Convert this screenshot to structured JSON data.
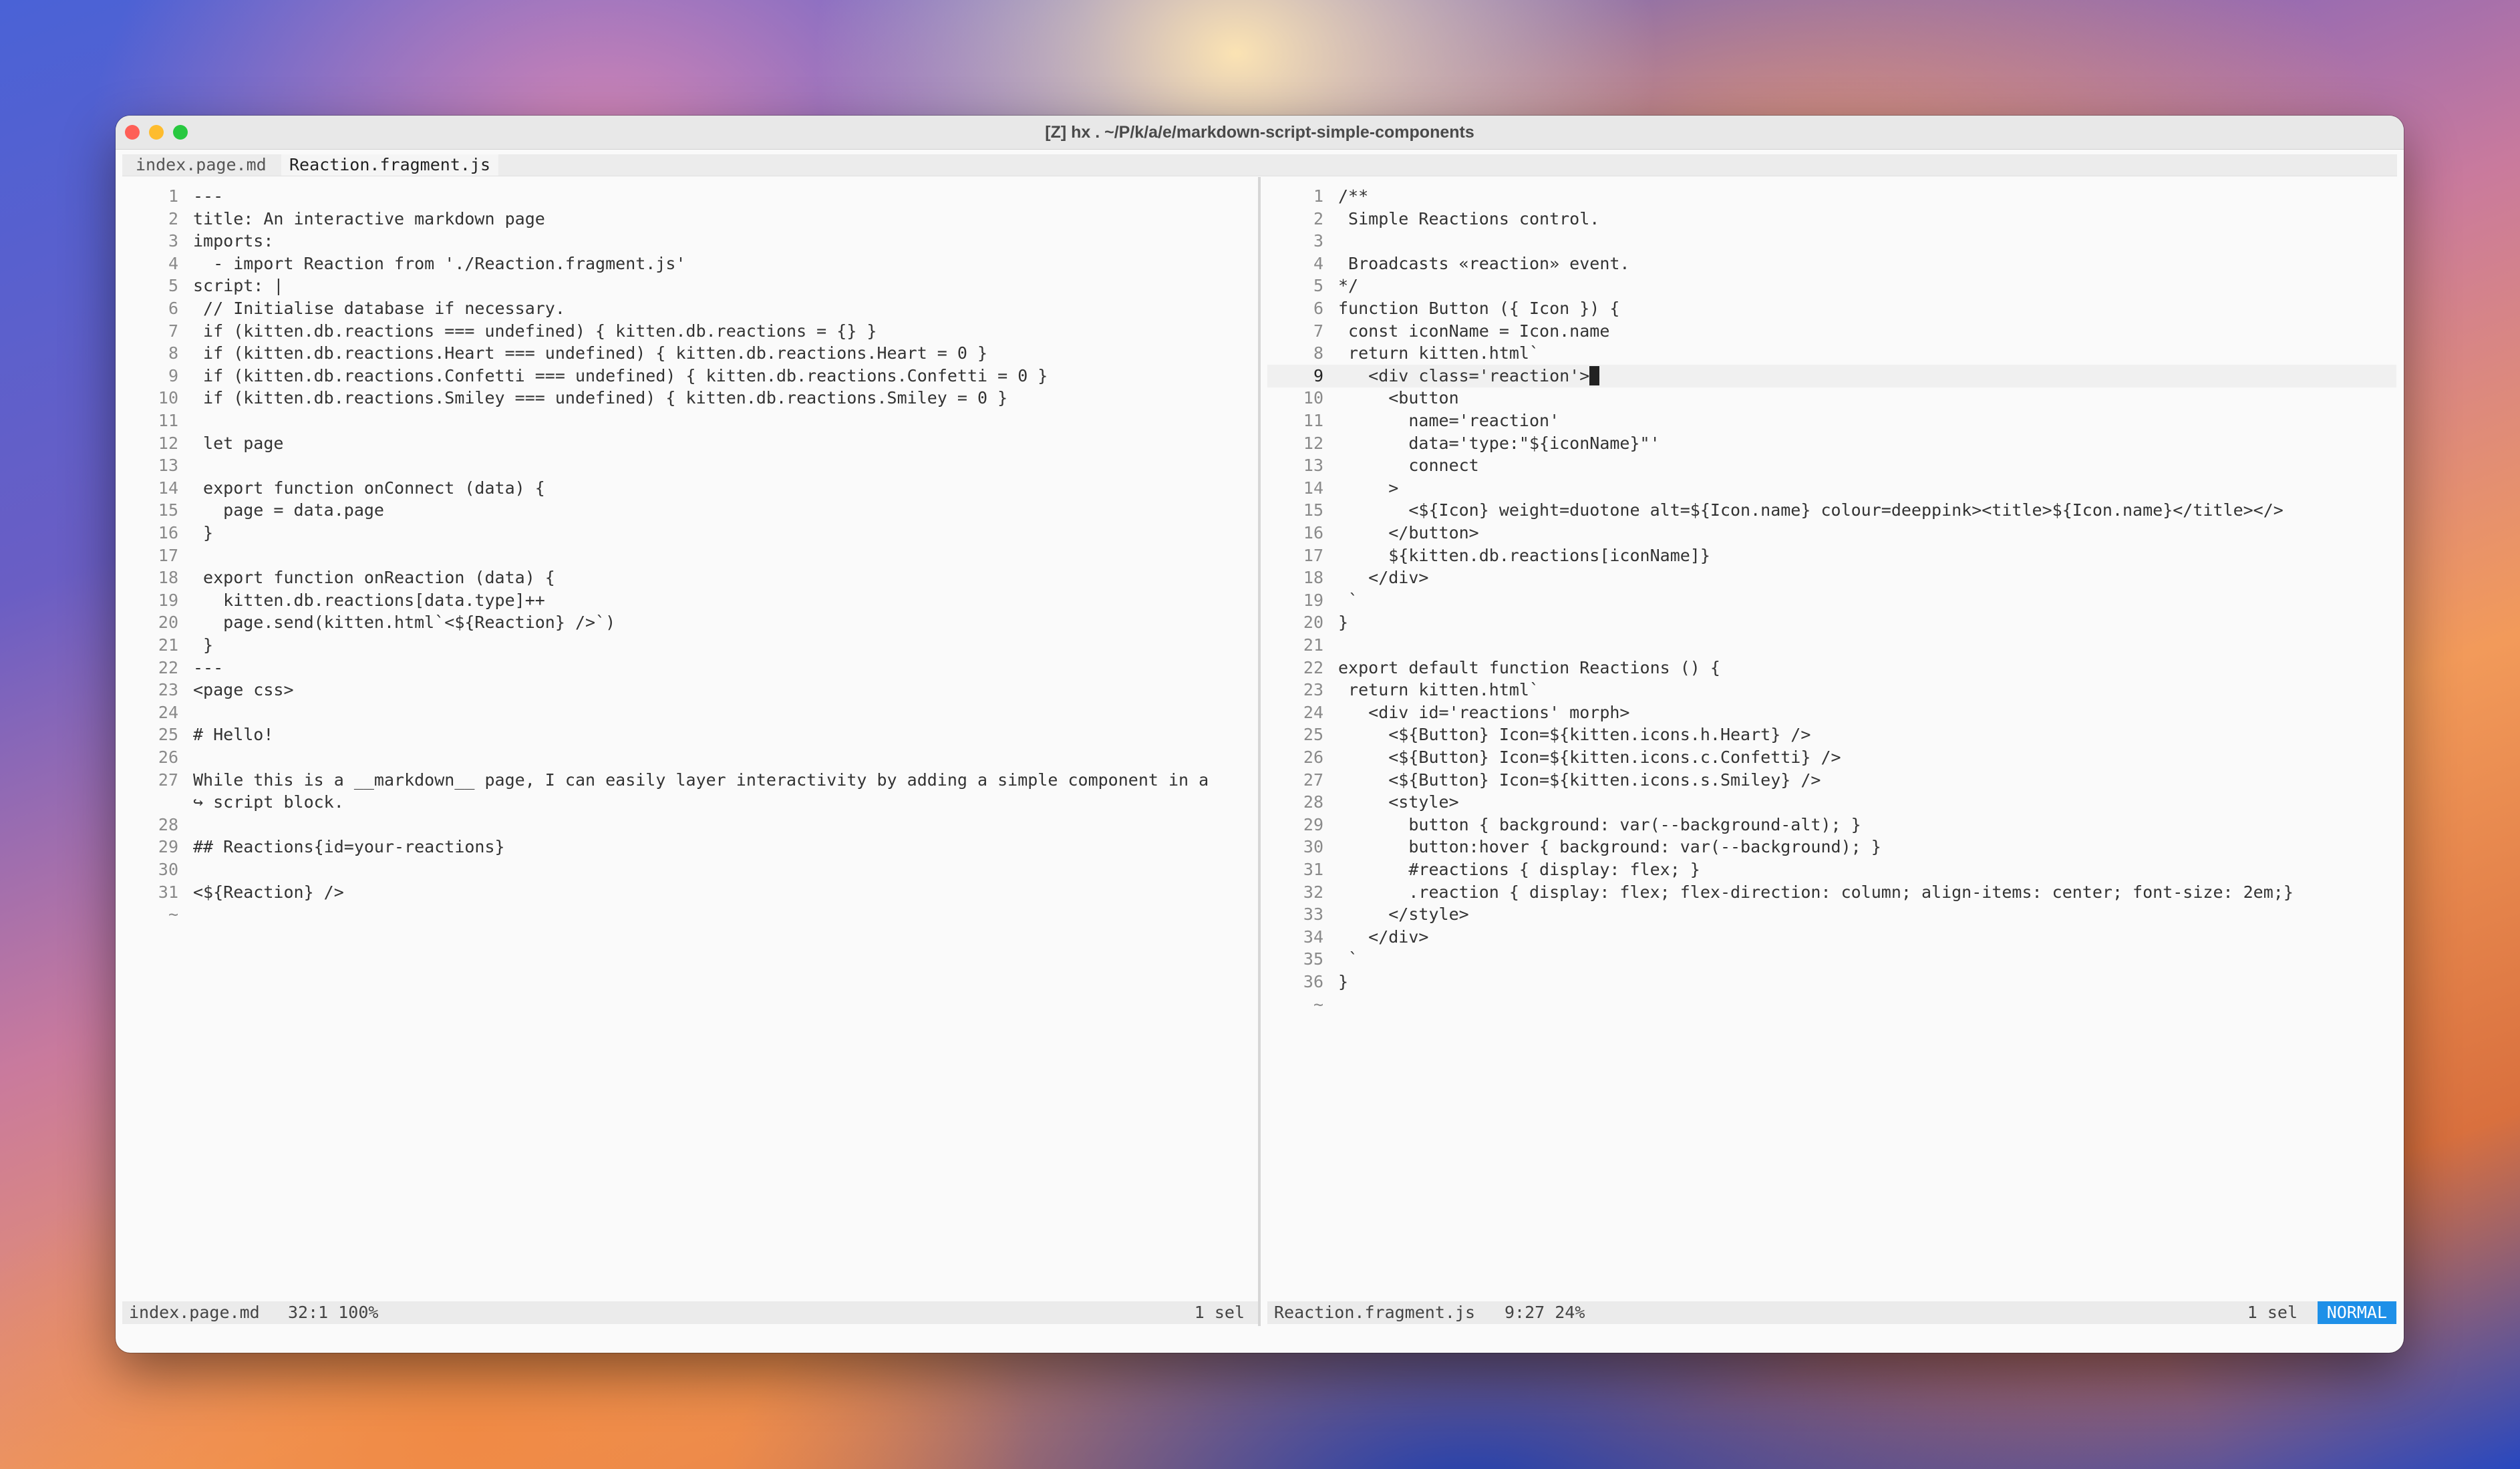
{
  "window": {
    "title": "[Z] hx . ~/P/k/a/e/markdown-script-simple-components"
  },
  "tabs": [
    {
      "label": "index.page.md",
      "active": false
    },
    {
      "label": "Reaction.fragment.js",
      "active": true
    }
  ],
  "left_pane": {
    "lines": [
      {
        "n": "1",
        "text": "---"
      },
      {
        "n": "2",
        "text": "title: An interactive markdown page"
      },
      {
        "n": "3",
        "text": "imports:"
      },
      {
        "n": "4",
        "text": "  - import Reaction from './Reaction.fragment.js'"
      },
      {
        "n": "5",
        "text": "script: |"
      },
      {
        "n": "6",
        "text": " // Initialise database if necessary."
      },
      {
        "n": "7",
        "text": " if (kitten.db.reactions === undefined) { kitten.db.reactions = {} }"
      },
      {
        "n": "8",
        "text": " if (kitten.db.reactions.Heart === undefined) { kitten.db.reactions.Heart = 0 }"
      },
      {
        "n": "9",
        "text": " if (kitten.db.reactions.Confetti === undefined) { kitten.db.reactions.Confetti = 0 }"
      },
      {
        "n": "10",
        "text": " if (kitten.db.reactions.Smiley === undefined) { kitten.db.reactions.Smiley = 0 }"
      },
      {
        "n": "11",
        "text": ""
      },
      {
        "n": "12",
        "text": " let page"
      },
      {
        "n": "13",
        "text": ""
      },
      {
        "n": "14",
        "text": " export function onConnect (data) {"
      },
      {
        "n": "15",
        "text": "   page = data.page"
      },
      {
        "n": "16",
        "text": " }"
      },
      {
        "n": "17",
        "text": ""
      },
      {
        "n": "18",
        "text": " export function onReaction (data) {"
      },
      {
        "n": "19",
        "text": "   kitten.db.reactions[data.type]++"
      },
      {
        "n": "20",
        "text": "   page.send(kitten.html`<${Reaction} />`)"
      },
      {
        "n": "21",
        "text": " }"
      },
      {
        "n": "22",
        "text": "---"
      },
      {
        "n": "23",
        "text": "<page css>"
      },
      {
        "n": "24",
        "text": ""
      },
      {
        "n": "25",
        "text": "# Hello!"
      },
      {
        "n": "26",
        "text": ""
      },
      {
        "n": "27",
        "text": "While this is a __markdown__ page, I can easily layer interactivity by adding a simple component in a"
      },
      {
        "n": "",
        "text": "↪ script block."
      },
      {
        "n": "28",
        "text": ""
      },
      {
        "n": "29",
        "text": "## Reactions{id=your-reactions}"
      },
      {
        "n": "30",
        "text": ""
      },
      {
        "n": "31",
        "text": "<${Reaction} />"
      },
      {
        "n": "~",
        "text": ""
      }
    ]
  },
  "right_pane": {
    "cursor_line": "9",
    "lines": [
      {
        "n": "1",
        "text": "/**"
      },
      {
        "n": "2",
        "text": " Simple Reactions control."
      },
      {
        "n": "3",
        "text": ""
      },
      {
        "n": "4",
        "text": " Broadcasts «reaction» event."
      },
      {
        "n": "5",
        "text": "*/"
      },
      {
        "n": "6",
        "text": "function Button ({ Icon }) {"
      },
      {
        "n": "7",
        "text": " const iconName = Icon.name"
      },
      {
        "n": "8",
        "text": " return kitten.html`"
      },
      {
        "n": "9",
        "text": "   <div class='reaction'>"
      },
      {
        "n": "10",
        "text": "     <button"
      },
      {
        "n": "11",
        "text": "       name='reaction'"
      },
      {
        "n": "12",
        "text": "       data='type:\"${iconName}\"'"
      },
      {
        "n": "13",
        "text": "       connect"
      },
      {
        "n": "14",
        "text": "     >"
      },
      {
        "n": "15",
        "text": "       <${Icon} weight=duotone alt=${Icon.name} colour=deeppink><title>${Icon.name}</title></>"
      },
      {
        "n": "16",
        "text": "     </button>"
      },
      {
        "n": "17",
        "text": "     ${kitten.db.reactions[iconName]}"
      },
      {
        "n": "18",
        "text": "   </div>"
      },
      {
        "n": "19",
        "text": " `"
      },
      {
        "n": "20",
        "text": "}"
      },
      {
        "n": "21",
        "text": ""
      },
      {
        "n": "22",
        "text": "export default function Reactions () {"
      },
      {
        "n": "23",
        "text": " return kitten.html`"
      },
      {
        "n": "24",
        "text": "   <div id='reactions' morph>"
      },
      {
        "n": "25",
        "text": "     <${Button} Icon=${kitten.icons.h.Heart} />"
      },
      {
        "n": "26",
        "text": "     <${Button} Icon=${kitten.icons.c.Confetti} />"
      },
      {
        "n": "27",
        "text": "     <${Button} Icon=${kitten.icons.s.Smiley} />"
      },
      {
        "n": "28",
        "text": "     <style>"
      },
      {
        "n": "29",
        "text": "       button { background: var(--background-alt); }"
      },
      {
        "n": "30",
        "text": "       button:hover { background: var(--background); }"
      },
      {
        "n": "31",
        "text": "       #reactions { display: flex; }"
      },
      {
        "n": "32",
        "text": "       .reaction { display: flex; flex-direction: column; align-items: center; font-size: 2em;}"
      },
      {
        "n": "33",
        "text": "     </style>"
      },
      {
        "n": "34",
        "text": "   </div>"
      },
      {
        "n": "35",
        "text": " `"
      },
      {
        "n": "36",
        "text": "}"
      },
      {
        "n": "~",
        "text": ""
      }
    ]
  },
  "status_left": {
    "file": "index.page.md",
    "pos": "32:1 100%",
    "sel": "1 sel"
  },
  "status_right": {
    "file": "Reaction.fragment.js",
    "pos": "9:27 24%",
    "sel": "1 sel",
    "mode": "NORMAL"
  }
}
